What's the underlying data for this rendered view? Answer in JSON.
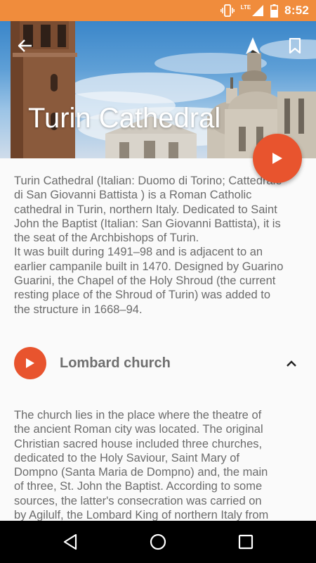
{
  "status_bar": {
    "time": "8:52",
    "network": "LTE",
    "icons": [
      "vibrate-icon",
      "signal-icon",
      "battery-icon"
    ]
  },
  "hero": {
    "title": "Turin Cathedral",
    "icons": [
      "back-arrow-icon",
      "navigation-icon",
      "bookmark-icon",
      "play-icon"
    ]
  },
  "content": {
    "intro": "Turin Cathedral (Italian: Duomo di Torino; Cattedrale\ndi San Giovanni Battista ) is a Roman Catholic\ncathedral in Turin, northern Italy. Dedicated to Saint\nJohn the Baptist (Italian: San Giovanni Battista), it is\nthe seat of the Archbishops of Turin.\nIt was built during 1491–98 and is adjacent to an\nearlier campanile built in 1470. Designed by Guarino\nGuarini, the Chapel of the Holy Shroud (the current\nresting place of the Shroud of Turin) was added to\nthe structure in 1668–94.",
    "section": {
      "title": "Lombard church",
      "body": "The church lies in the place where the theatre of\nthe ancient Roman city was located. The original\nChristian sacred house included three churches,\ndedicated to the Holy Saviour, Saint Mary of\nDompno (Santa Maria de Dompno) and, the main\nof three, St. John the Baptist. According to some\nsources, the latter's consecration was carried on\nby Agilulf, the Lombard King of northern Italy from"
    }
  },
  "nav_bar": {
    "icons": [
      "back-triangle-icon",
      "home-circle-icon",
      "recents-square-icon"
    ]
  },
  "colors": {
    "status_bar": "#f08c3c",
    "accent": "#e8542e",
    "body_text": "#6b6b6b",
    "background": "#fafafa"
  }
}
